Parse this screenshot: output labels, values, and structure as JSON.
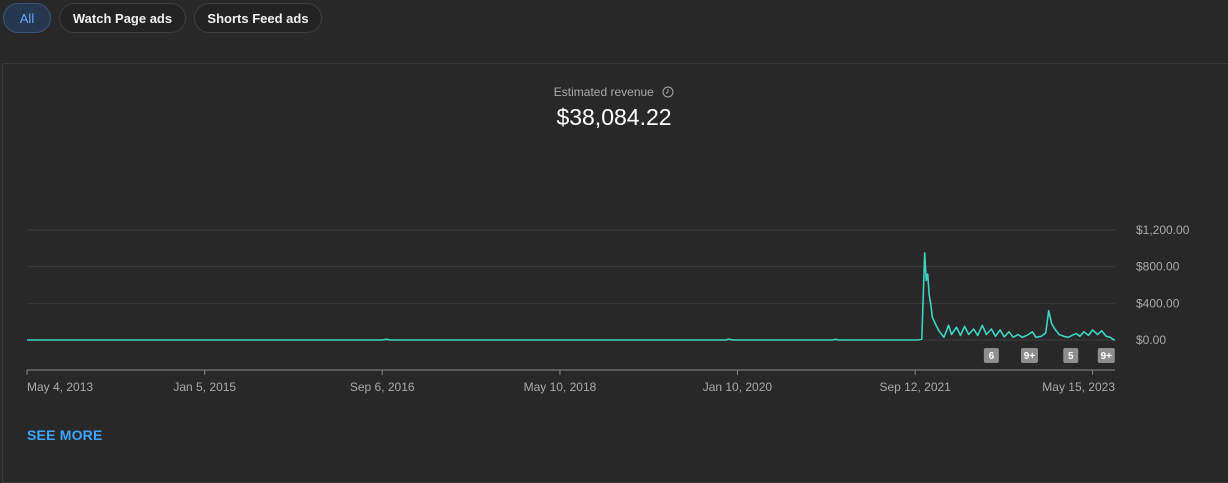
{
  "filters": [
    {
      "label": "All",
      "active": true
    },
    {
      "label": "Watch Page ads",
      "active": false
    },
    {
      "label": "Shorts Feed ads",
      "active": false
    }
  ],
  "metric": {
    "label": "Estimated revenue",
    "value": "$38,084.22"
  },
  "see_more": "SEE MORE",
  "colors": {
    "line": "#3dd4c6",
    "accent": "#3ea6ff",
    "background": "#282828"
  },
  "chart_data": {
    "type": "line",
    "xlabel": "",
    "ylabel": "",
    "xlim": [
      "2013-05-04",
      "2023-07-31"
    ],
    "ylim": [
      0,
      1200
    ],
    "grid": true,
    "y_tick_labels": [
      "$0.00",
      "$400.00",
      "$800.00",
      "$1,200.00"
    ],
    "y_ticks": [
      0,
      400,
      800,
      1200
    ],
    "x_tick_labels": [
      "May 4, 2013",
      "Jan 5, 2015",
      "Sep 6, 2016",
      "May 10, 2018",
      "Jan 10, 2020",
      "Sep 12, 2021",
      "May 15, 2023"
    ],
    "x_ticks": [
      "2013-05-04",
      "2015-01-05",
      "2016-09-06",
      "2018-05-10",
      "2020-01-10",
      "2021-09-12",
      "2023-05-15"
    ],
    "annotations": [
      {
        "label": "6",
        "date": "2022-06-01"
      },
      {
        "label": "9+",
        "date": "2022-10-10"
      },
      {
        "label": "5",
        "date": "2023-03-01"
      },
      {
        "label": "9+",
        "date": "2023-07-01"
      }
    ],
    "series": [
      {
        "points": [
          [
            "2013-05-04",
            0
          ],
          [
            "2016-09-06",
            0
          ],
          [
            "2016-09-20",
            8
          ],
          [
            "2016-10-05",
            0
          ],
          [
            "2019-12-01",
            0
          ],
          [
            "2019-12-12",
            10
          ],
          [
            "2019-12-25",
            0
          ],
          [
            "2020-12-01",
            0
          ],
          [
            "2020-12-12",
            6
          ],
          [
            "2020-12-25",
            0
          ],
          [
            "2021-09-20",
            0
          ],
          [
            "2021-10-05",
            10
          ],
          [
            "2021-10-15",
            950
          ],
          [
            "2021-10-20",
            650
          ],
          [
            "2021-10-25",
            720
          ],
          [
            "2021-10-30",
            500
          ],
          [
            "2021-11-05",
            380
          ],
          [
            "2021-11-10",
            250
          ],
          [
            "2021-11-20",
            180
          ],
          [
            "2021-12-01",
            110
          ],
          [
            "2021-12-10",
            70
          ],
          [
            "2021-12-20",
            30
          ],
          [
            "2022-01-05",
            160
          ],
          [
            "2022-01-15",
            60
          ],
          [
            "2022-02-01",
            140
          ],
          [
            "2022-02-15",
            50
          ],
          [
            "2022-03-01",
            150
          ],
          [
            "2022-03-15",
            60
          ],
          [
            "2022-04-01",
            120
          ],
          [
            "2022-04-15",
            50
          ],
          [
            "2022-05-01",
            160
          ],
          [
            "2022-05-15",
            60
          ],
          [
            "2022-06-01",
            120
          ],
          [
            "2022-06-15",
            40
          ],
          [
            "2022-07-01",
            110
          ],
          [
            "2022-07-15",
            35
          ],
          [
            "2022-08-01",
            90
          ],
          [
            "2022-08-15",
            30
          ],
          [
            "2022-09-01",
            60
          ],
          [
            "2022-09-15",
            30
          ],
          [
            "2022-10-01",
            50
          ],
          [
            "2022-10-20",
            90
          ],
          [
            "2022-11-01",
            30
          ],
          [
            "2022-11-20",
            40
          ],
          [
            "2022-12-05",
            80
          ],
          [
            "2022-12-15",
            320
          ],
          [
            "2022-12-25",
            180
          ],
          [
            "2023-01-05",
            120
          ],
          [
            "2023-01-20",
            60
          ],
          [
            "2023-02-05",
            40
          ],
          [
            "2023-02-20",
            30
          ],
          [
            "2023-03-05",
            50
          ],
          [
            "2023-03-20",
            70
          ],
          [
            "2023-04-01",
            40
          ],
          [
            "2023-04-15",
            90
          ],
          [
            "2023-05-01",
            50
          ],
          [
            "2023-05-15",
            110
          ],
          [
            "2023-06-01",
            60
          ],
          [
            "2023-06-15",
            100
          ],
          [
            "2023-07-01",
            40
          ],
          [
            "2023-07-15",
            30
          ],
          [
            "2023-07-25",
            5
          ],
          [
            "2023-07-31",
            0
          ]
        ]
      }
    ]
  }
}
